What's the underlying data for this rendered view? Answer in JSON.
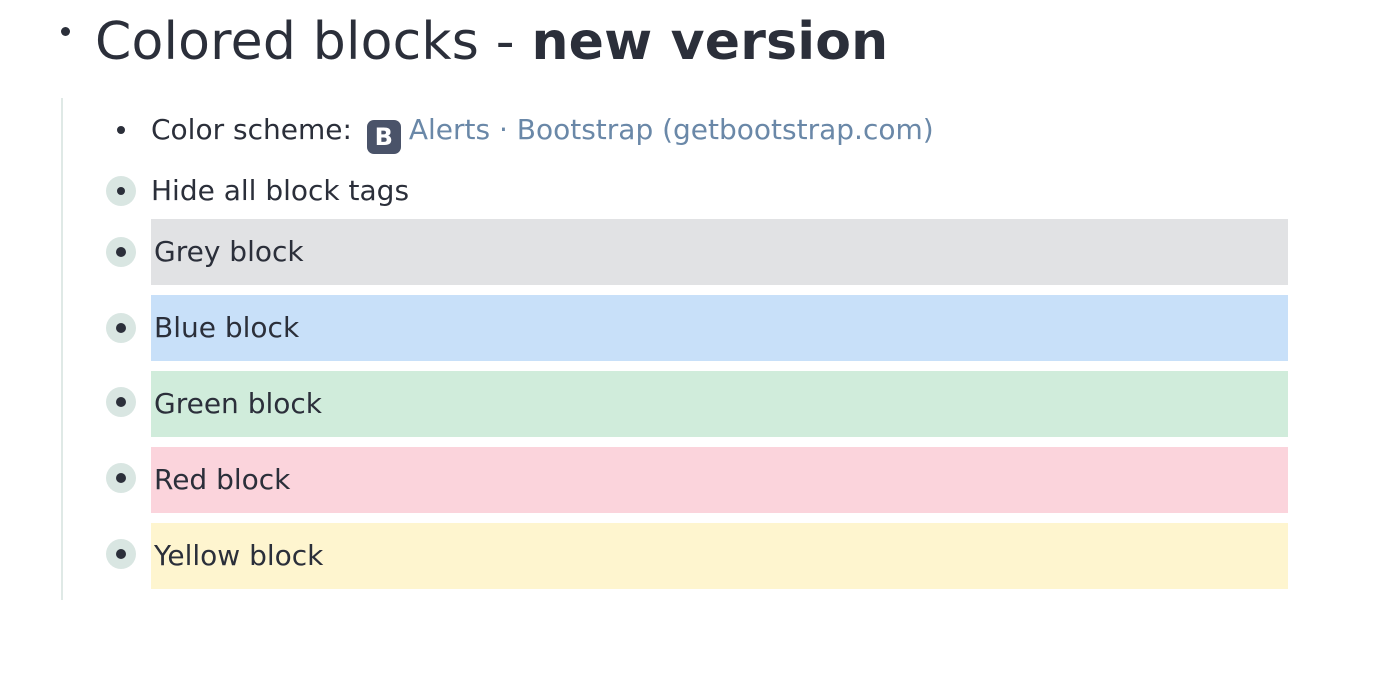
{
  "heading": {
    "title_regular": "Colored blocks - ",
    "title_bold": "new version"
  },
  "children": {
    "color_scheme": {
      "label": "Color scheme:",
      "icon_letter": "B",
      "icon_name": "bootstrap-icon",
      "link_text": "Alerts · Bootstrap (getbootstrap.com)"
    },
    "hide_tags": {
      "label": "Hide all block tags"
    },
    "blocks": [
      {
        "label": "Grey block",
        "color": "#e1e2e4"
      },
      {
        "label": "Blue block",
        "color": "#c8e0f9"
      },
      {
        "label": "Green block",
        "color": "#d0ecdb"
      },
      {
        "label": "Red block",
        "color": "#fbd4dc"
      },
      {
        "label": "Yellow block",
        "color": "#fef5cf"
      }
    ]
  },
  "colors": {
    "text": "#2b2f3a",
    "link": "#6a88a8",
    "bullet_halo": "#d9e6e2",
    "thread_line": "#dfe9e6"
  }
}
